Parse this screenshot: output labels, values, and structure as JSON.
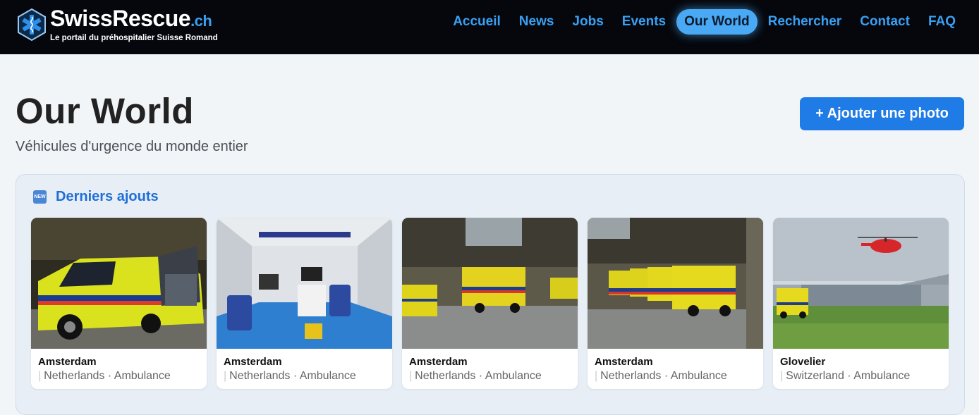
{
  "brand": {
    "name": "SwissRescue",
    "tld": ".ch",
    "tagline": "Le portail du préhospitalier Suisse Romand"
  },
  "nav": [
    {
      "label": "Accueil",
      "active": false
    },
    {
      "label": "News",
      "active": false
    },
    {
      "label": "Jobs",
      "active": false
    },
    {
      "label": "Events",
      "active": false
    },
    {
      "label": "Our World",
      "active": true
    },
    {
      "label": "Rechercher",
      "active": false
    },
    {
      "label": "Contact",
      "active": false
    },
    {
      "label": "FAQ",
      "active": false
    }
  ],
  "page": {
    "title": "Our World",
    "subtitle": "Véhicules d'urgence du monde entier",
    "add_button": "+ Ajouter une photo"
  },
  "latest": {
    "icon": "new-badge-icon",
    "icon_text": "NEW",
    "title": "Derniers ajouts",
    "cards": [
      {
        "city": "Amsterdam",
        "meta": "Netherlands · Ambulance"
      },
      {
        "city": "Amsterdam",
        "meta": "Netherlands · Ambulance"
      },
      {
        "city": "Amsterdam",
        "meta": "Netherlands · Ambulance"
      },
      {
        "city": "Amsterdam",
        "meta": "Netherlands · Ambulance"
      },
      {
        "city": "Glovelier",
        "meta": "Switzerland · Ambulance"
      }
    ]
  },
  "colors": {
    "header_bg": "#05070c",
    "accent": "#3aa0f3",
    "button": "#1f7ce6",
    "panel_title": "#1f6fd9"
  }
}
